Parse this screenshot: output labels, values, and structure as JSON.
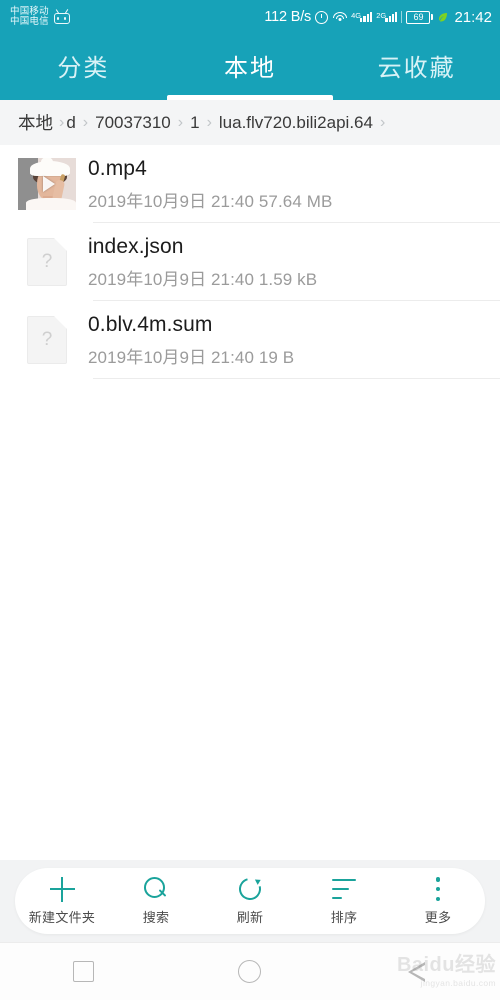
{
  "status_bar": {
    "carrier_line1": "中国移动",
    "carrier_line2": "中国电信",
    "app_icon": "bilibili-tv-icon",
    "net_speed": "112 B/s",
    "alarm_icon": "alarm-clock-icon",
    "wifi_icon": "wifi-icon",
    "sim1_generation": "4G",
    "sim2_generation": "2G",
    "battery_level": "69",
    "power_save_icon": "leaf-icon",
    "clock": "21:42"
  },
  "tabs": [
    {
      "label": "分类",
      "active": false,
      "name": "tab-category"
    },
    {
      "label": "本地",
      "active": true,
      "name": "tab-local"
    },
    {
      "label": "云收藏",
      "active": false,
      "name": "tab-cloud-favorites"
    }
  ],
  "breadcrumb": {
    "separator": "›",
    "items": [
      "本地",
      "d",
      "70037310",
      "1",
      "lua.flv720.bili2api.64"
    ]
  },
  "files": [
    {
      "name": "0.mp4",
      "date": "2019年10月9日",
      "time": "21:40",
      "size": "57.64 MB",
      "subtitle": "2019年10月9日 21:40 57.64 MB",
      "icon": "video-thumbnail",
      "type": "video"
    },
    {
      "name": "index.json",
      "date": "2019年10月9日",
      "time": "21:40",
      "size": "1.59 kB",
      "subtitle": "2019年10月9日 21:40 1.59 kB",
      "icon": "unknown-file-icon",
      "type": "unknown"
    },
    {
      "name": "0.blv.4m.sum",
      "date": "2019年10月9日",
      "time": "21:40",
      "size": "19 B",
      "subtitle": "2019年10月9日 21:40 19 B",
      "icon": "unknown-file-icon",
      "type": "unknown"
    }
  ],
  "toolbar": [
    {
      "label": "新建文件夹",
      "icon": "plus-icon",
      "name": "new-folder-button"
    },
    {
      "label": "搜索",
      "icon": "search-icon",
      "name": "search-button"
    },
    {
      "label": "刷新",
      "icon": "refresh-icon",
      "name": "refresh-button"
    },
    {
      "label": "排序",
      "icon": "sort-icon",
      "name": "sort-button"
    },
    {
      "label": "更多",
      "icon": "more-icon",
      "name": "more-button"
    }
  ],
  "nav_bar": {
    "recents_icon": "square-recents-icon",
    "home_icon": "circle-home-icon",
    "back_icon": "triangle-back-icon"
  },
  "watermark": {
    "main": "Baidu经验",
    "sub": "jingyan.baidu.com"
  },
  "colors": {
    "header": "#17A2B8",
    "accent": "#1AA39B",
    "breadcrumb_bg": "#F4F5F6",
    "toolbar_bg": "#F2F3F4"
  }
}
